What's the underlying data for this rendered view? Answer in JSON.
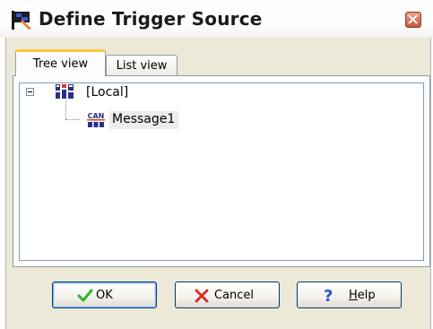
{
  "window": {
    "title": "Define Trigger Source",
    "title_icon": "flag-icon",
    "close_icon": "close-icon"
  },
  "tabs": [
    {
      "label": "Tree view",
      "selected": true
    },
    {
      "label": "List view",
      "selected": false
    }
  ],
  "tree": {
    "root": {
      "label": "[Local]",
      "icon": "network-node-icon",
      "expanded": true
    },
    "children": [
      {
        "label": "Message1",
        "icon": "can-message-icon",
        "selected": true
      }
    ]
  },
  "buttons": {
    "ok": {
      "label": "OK",
      "icon": "checkmark-icon"
    },
    "cancel": {
      "label": "Cancel",
      "icon": "x-icon"
    },
    "help": {
      "label": "Help",
      "icon": "question-icon",
      "icon_glyph": "?"
    }
  },
  "colors": {
    "dialog_bg": "#ece9d8",
    "selected_tab_accent": "#ffc83c",
    "button_border": "#003c74",
    "ok_check": "#2db52d",
    "cancel_x": "#d9261c",
    "help_question": "#2553d8"
  }
}
